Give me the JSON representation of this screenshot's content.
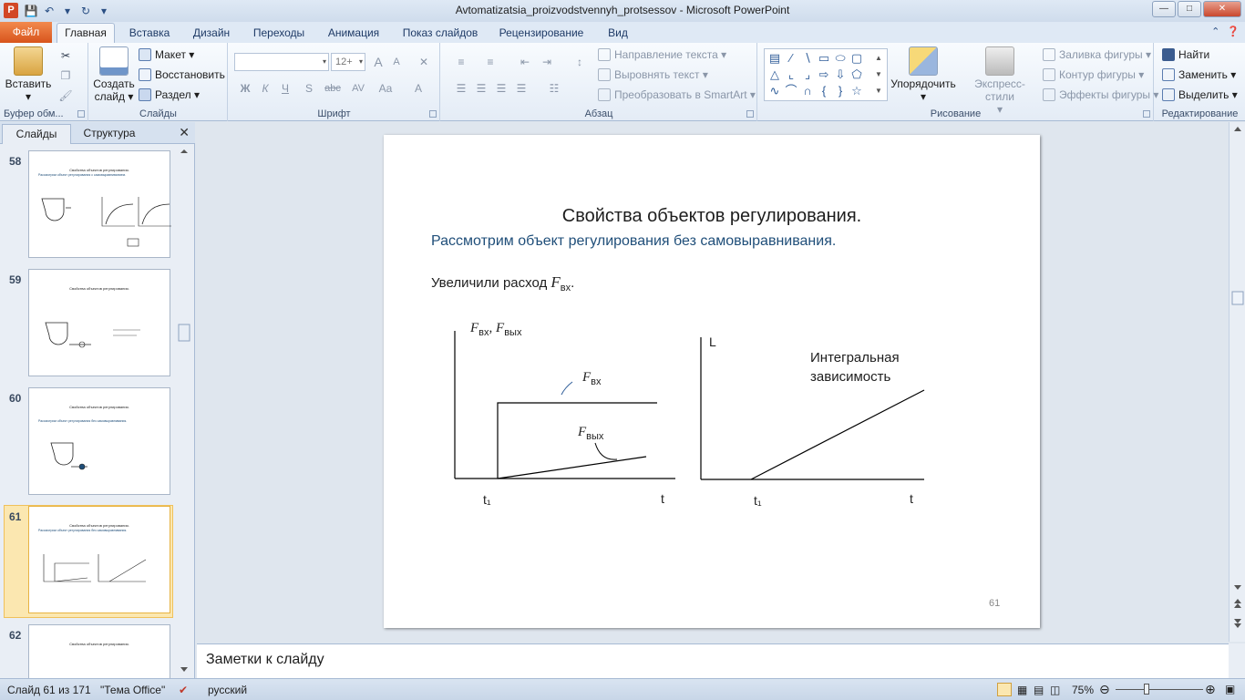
{
  "window": {
    "app_letter": "P",
    "title": "Avtomatizatsia_proizvodstvennyh_protsessov  -  Microsoft PowerPoint"
  },
  "tabs": {
    "file": "Файл",
    "items": [
      "Главная",
      "Вставка",
      "Дизайн",
      "Переходы",
      "Анимация",
      "Показ слайдов",
      "Рецензирование",
      "Вид"
    ],
    "active": "Главная"
  },
  "ribbon": {
    "clipboard": {
      "label": "Буфер обм...",
      "paste": "Вставить"
    },
    "slides": {
      "label": "Слайды",
      "create": "Создать",
      "create2": "слайд",
      "layout": "Макет",
      "reset": "Восстановить",
      "section": "Раздел"
    },
    "font": {
      "label": "Шрифт",
      "size": "12+",
      "bold": "Ж",
      "italic": "К",
      "underline": "Ч",
      "shadow": "S",
      "strike": "abc",
      "spacing": "AV",
      "case": "Aa",
      "grow": "A",
      "shrink": "A",
      "color": "A"
    },
    "paragraph": {
      "label": "Абзац",
      "direction": "Направление текста",
      "align": "Выровнять текст",
      "smartart": "Преобразовать в SmartArt"
    },
    "drawing": {
      "label": "Рисование",
      "arrange": "Упорядочить",
      "quickstyles": "Экспресс-стили",
      "fill": "Заливка фигуры",
      "outline": "Контур фигуры",
      "effects": "Эффекты фигуры"
    },
    "editing": {
      "label": "Редактирование",
      "find": "Найти",
      "replace": "Заменить",
      "select": "Выделить"
    }
  },
  "left_panel": {
    "tab_slides": "Слайды",
    "tab_outline": "Структура",
    "thumbs": [
      {
        "num": "58",
        "title": "Свойства объектов регулирования.",
        "sub": "Рассмотрим объект регулирования с самовыравниванием."
      },
      {
        "num": "59",
        "title": "Свойства объектов регулирования.",
        "sub": ""
      },
      {
        "num": "60",
        "title": "Свойства объектов регулирования.",
        "sub": "Рассмотрим объект регулирования без самовыравнивания."
      },
      {
        "num": "61",
        "title": "Свойства объектов регулирования.",
        "sub": "Рассмотрим объект регулирования без самовыравнивания."
      },
      {
        "num": "62",
        "title": "Свойства объектов регулирования.",
        "sub": ""
      }
    ]
  },
  "slide": {
    "title": "Свойства объектов регулирования.",
    "subtitle": "Рассмотрим объект регулирования без самовыравнивания.",
    "body_text": "Увеличили расход ",
    "body_var": "F",
    "body_sub": "вх",
    "body_end": ".",
    "left_chart": {
      "ylabel_f1": "F",
      "ylabel_s1": "вх",
      "ylabel_sep": ", ",
      "ylabel_f2": "F",
      "ylabel_s2": "вых",
      "fin_f": "F",
      "fin_s": "вх",
      "fout_f": "F",
      "fout_s": "вых",
      "t1": "t₁",
      "t": "t"
    },
    "right_chart": {
      "ylabel": "L",
      "annot1": "Интегральная",
      "annot2": "зависимость",
      "t1": "t₁",
      "t": "t"
    },
    "page_number": "61"
  },
  "notes": {
    "placeholder": "Заметки к слайду"
  },
  "status": {
    "slide_info": "Слайд 61 из 171",
    "theme": "\"Тема Office\"",
    "language": "русский",
    "zoom": "75%"
  }
}
